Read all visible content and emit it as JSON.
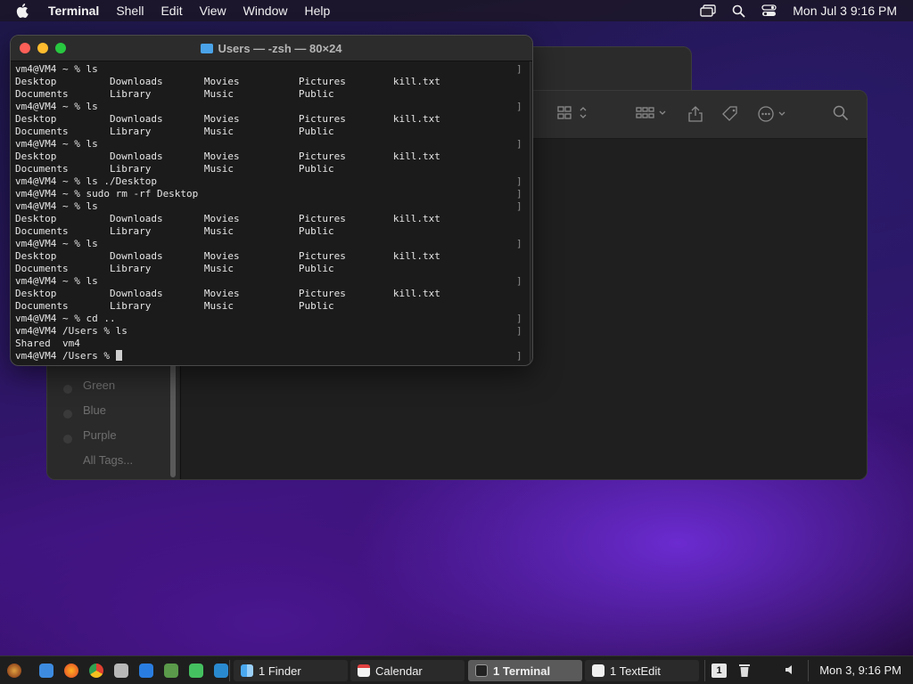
{
  "menubar": {
    "app": "Terminal",
    "items": [
      "Shell",
      "Edit",
      "View",
      "Window",
      "Help"
    ],
    "datetime": "Mon Jul 3  9:16 PM"
  },
  "finder": {
    "tags": [
      "Green",
      "Blue",
      "Purple",
      "All Tags..."
    ]
  },
  "terminal": {
    "title": "Users — -zsh — 80×24",
    "lines": [
      "vm4@VM4 ~ % ls",
      "Desktop         Downloads       Movies          Pictures        kill.txt",
      "Documents       Library         Music           Public",
      "vm4@VM4 ~ % ls",
      "Desktop         Downloads       Movies          Pictures        kill.txt",
      "Documents       Library         Music           Public",
      "vm4@VM4 ~ % ls",
      "Desktop         Downloads       Movies          Pictures        kill.txt",
      "Documents       Library         Music           Public",
      "vm4@VM4 ~ % ls ./Desktop",
      "vm4@VM4 ~ % sudo rm -rf Desktop",
      "vm4@VM4 ~ % ls",
      "Desktop         Downloads       Movies          Pictures        kill.txt",
      "Documents       Library         Music           Public",
      "vm4@VM4 ~ % ls",
      "Desktop         Downloads       Movies          Pictures        kill.txt",
      "Documents       Library         Music           Public",
      "vm4@VM4 ~ % ls",
      "Desktop         Downloads       Movies          Pictures        kill.txt",
      "Documents       Library         Music           Public",
      "vm4@VM4 ~ % cd ..",
      "vm4@VM4 /Users % ls",
      "Shared  vm4",
      "vm4@VM4 /Users % "
    ]
  },
  "taskbar": {
    "tasks": [
      "1 Finder",
      "Calendar",
      "1 Terminal",
      "1 TextEdit"
    ],
    "workspace": "1",
    "clock": "Mon 3, 9:16 PM"
  }
}
